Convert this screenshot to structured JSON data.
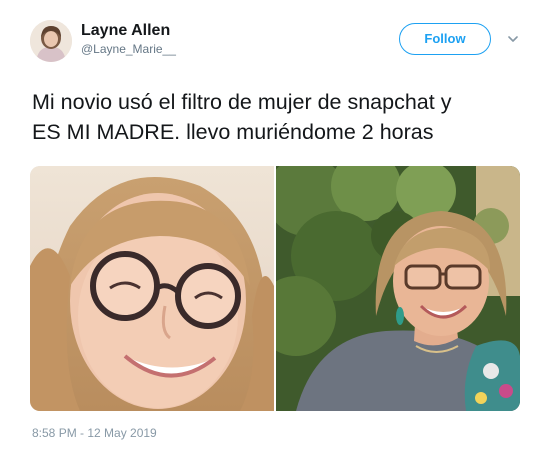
{
  "user": {
    "name": "Layne Allen",
    "handle": "@Layne_Marie__",
    "avatar_icon": "profile-avatar"
  },
  "actions": {
    "follow_label": "Follow",
    "menu_icon": "chevron-down-icon"
  },
  "tweet": {
    "text_line1": "Mi novio usó el filtro de mujer de snapchat y",
    "text_line2": "ES MI MADRE. llevo muriéndome 2 horas"
  },
  "media": {
    "left_photo": "young woman with round glasses (snapchat filter)",
    "right_photo": "smiling older woman with glasses outdoors"
  },
  "meta": {
    "timestamp": "8:58 PM - 12 May 2019"
  },
  "colors": {
    "accent": "#1da1f2",
    "text": "#14171a",
    "secondary": "#657786",
    "muted": "#8899a6"
  }
}
